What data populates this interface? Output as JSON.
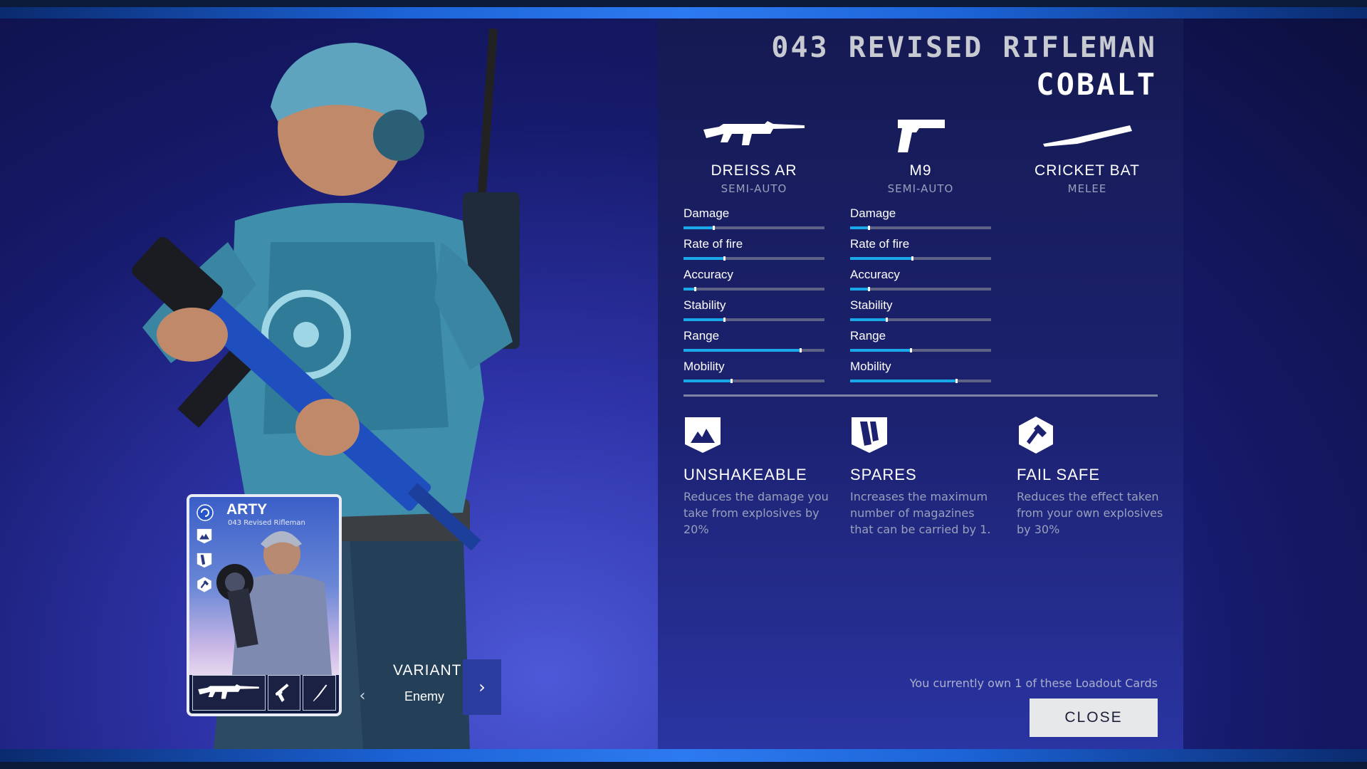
{
  "header": {
    "title": "043 REVISED RIFLEMAN",
    "variant_name": "COBALT"
  },
  "weapons": [
    {
      "name": "DREISS AR",
      "mode": "SEMI-AUTO",
      "icon": "assault-rifle-icon",
      "stats": [
        {
          "label": "Damage",
          "value": 0.21
        },
        {
          "label": "Rate of fire",
          "value": 0.29
        },
        {
          "label": "Accuracy",
          "value": 0.08
        },
        {
          "label": "Stability",
          "value": 0.29
        },
        {
          "label": "Range",
          "value": 0.83
        },
        {
          "label": "Mobility",
          "value": 0.34
        }
      ]
    },
    {
      "name": "M9",
      "mode": "SEMI-AUTO",
      "icon": "pistol-icon",
      "stats": [
        {
          "label": "Damage",
          "value": 0.13
        },
        {
          "label": "Rate of fire",
          "value": 0.44
        },
        {
          "label": "Accuracy",
          "value": 0.13
        },
        {
          "label": "Stability",
          "value": 0.26
        },
        {
          "label": "Range",
          "value": 0.43
        },
        {
          "label": "Mobility",
          "value": 0.75
        }
      ]
    },
    {
      "name": "CRICKET BAT",
      "mode": "MELEE",
      "icon": "cricket-bat-icon",
      "stats": []
    }
  ],
  "perks": [
    {
      "name": "UNSHAKEABLE",
      "icon": "mountain-shield-icon",
      "description": "Reduces the damage you take from explosives by 20%"
    },
    {
      "name": "SPARES",
      "icon": "magazines-icon",
      "description": "Increases the maximum number of magazines that can be carried by 1."
    },
    {
      "name": "FAIL SAFE",
      "icon": "detonator-icon",
      "description": "Reduces the effect taken from your own explosives by 30%"
    }
  ],
  "card": {
    "name": "ARTY",
    "subtitle": "043 Revised Rifleman"
  },
  "variant": {
    "label": "VARIANT",
    "value": "Enemy"
  },
  "footer": {
    "ownership": "You currently own 1 of these Loadout Cards",
    "close_label": "CLOSE"
  },
  "colors": {
    "stat_fill": "#1aa9e8",
    "stat_track": "#5e6386",
    "accent": "#2b3d9f"
  }
}
